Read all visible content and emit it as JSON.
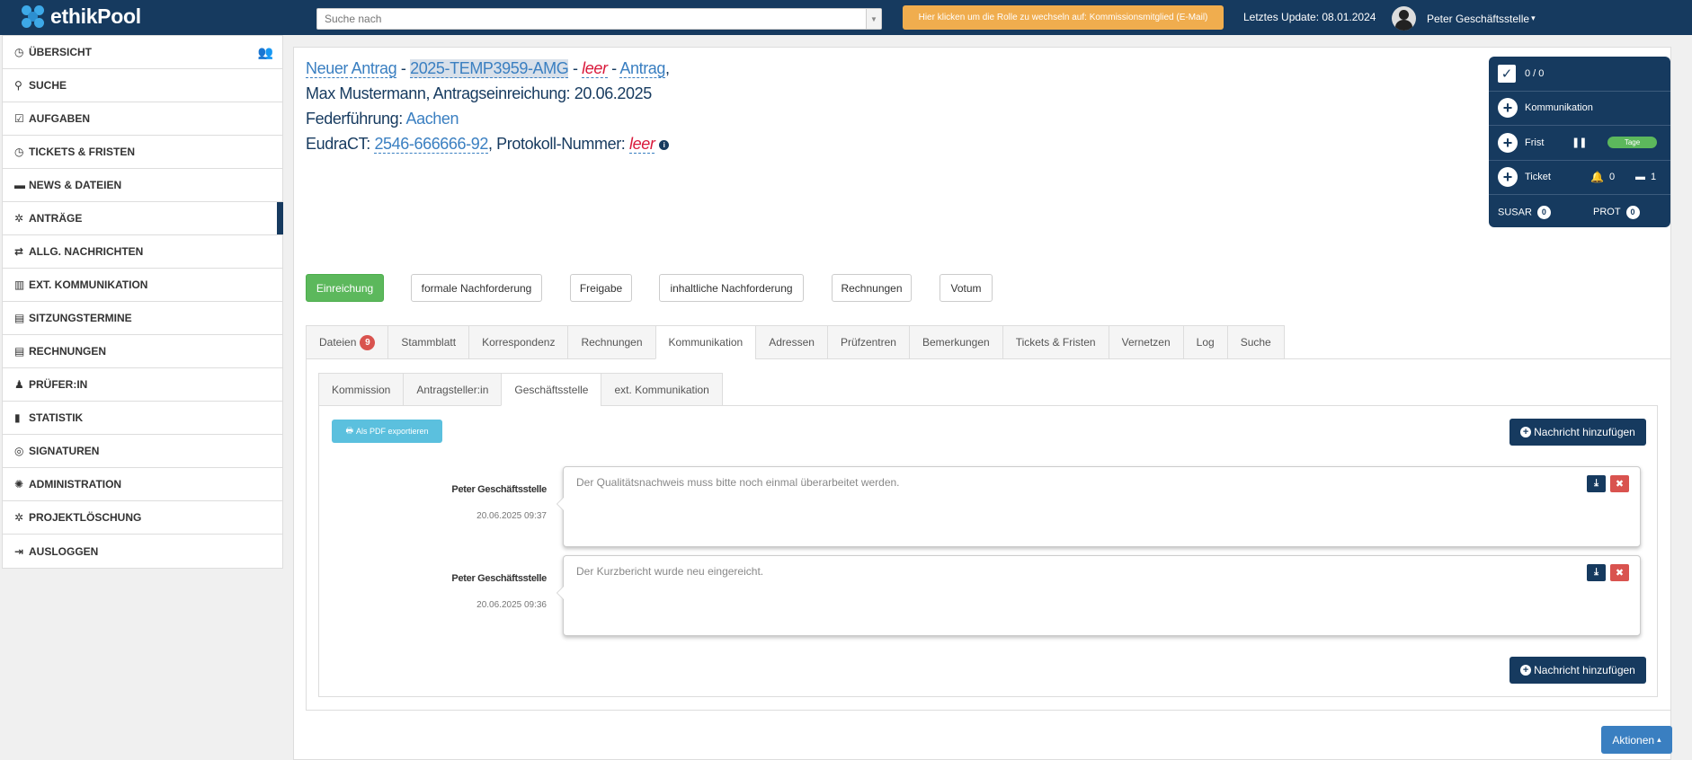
{
  "navbar": {
    "logo": "ethikPool",
    "search_placeholder": "Suche nach",
    "role_button": "Hier klicken um die Rolle zu wechseln auf: Kommissionsmitglied (E-Mail)",
    "last_update": "Letztes Update: 08.01.2024",
    "user_name": "Peter Geschäftsstelle",
    "user_caret": "▾"
  },
  "sidebar": {
    "items": [
      {
        "label": "ÜBERSICHT",
        "icon": "clock-icon",
        "glyph": "◷"
      },
      {
        "label": "SUCHE",
        "icon": "search-icon",
        "glyph": "⚲"
      },
      {
        "label": "AUFGABEN",
        "icon": "checkbox-icon",
        "glyph": "☑"
      },
      {
        "label": "TICKETS & FRISTEN",
        "icon": "clock-icon",
        "glyph": "◷"
      },
      {
        "label": "NEWS & DATEIEN",
        "icon": "comment-icon",
        "glyph": "▬"
      },
      {
        "label": "ANTRÄGE",
        "icon": "gear-icon",
        "glyph": "✲"
      },
      {
        "label": "ALLG. NACHRICHTEN",
        "icon": "transfer-icon",
        "glyph": "⇄"
      },
      {
        "label": "EXT. KOMMUNIKATION",
        "icon": "building-icon",
        "glyph": "▥"
      },
      {
        "label": "SITZUNGSTERMINE",
        "icon": "book-icon",
        "glyph": "▤"
      },
      {
        "label": "RECHNUNGEN",
        "icon": "list-icon",
        "glyph": "▤"
      },
      {
        "label": "PRÜFER:IN",
        "icon": "user-icon",
        "glyph": "♟"
      },
      {
        "label": "STATISTIK",
        "icon": "stats-icon",
        "glyph": "▮"
      },
      {
        "label": "SIGNATUREN",
        "icon": "fingerprint-icon",
        "glyph": "◎"
      },
      {
        "label": "ADMINISTRATION",
        "icon": "cog-icon",
        "glyph": "✺"
      },
      {
        "label": "PROJEKTLÖSCHUNG",
        "icon": "gear-icon",
        "glyph": "✲"
      },
      {
        "label": "AUSLOGGEN",
        "icon": "logout-icon",
        "glyph": "⇥"
      }
    ],
    "people_icon_glyph": "👥"
  },
  "header": {
    "neuer_antrag": "Neuer Antrag",
    "sep1": " - ",
    "temp_id": "2025-TEMP3959-AMG",
    "sep2": " - ",
    "leer1": "leer",
    "sep3": " - ",
    "antrag": "Antrag",
    "comma1": ",",
    "line2": "Max Mustermann, Antragseinreichung: 20.06.2025",
    "federfuehrung_label": "Federführung: ",
    "federfuehrung_value": "Aachen",
    "eudract_label": "EudraCT: ",
    "eudract_value": "2546-666666-92",
    "protokoll_label": ", Protokoll-Nummer: ",
    "leer2": "leer",
    "info_glyph": "i"
  },
  "widget": {
    "check_glyph": "✓",
    "count": "0 / 0",
    "plus_glyph": "+",
    "kommunikation": "Kommunikation",
    "frist": "Frist",
    "pause_glyph": "❚❚",
    "tage": "Tage",
    "ticket": "Ticket",
    "bell_glyph": "🔔",
    "bell_count": "0",
    "ticket_glyph": "▬",
    "ticket_count": "1",
    "susar": "SUSAR",
    "susar_count": "0",
    "prot": "PROT",
    "prot_count": "0"
  },
  "actions": {
    "einreichung": "Einreichung",
    "formale": "formale Nachforderung",
    "freigabe": "Freigabe",
    "inhaltliche": "inhaltliche Nachforderung",
    "rechnungen": "Rechnungen",
    "votum": "Votum"
  },
  "tabs": {
    "dateien": "Dateien",
    "dateien_count": "9",
    "stammblatt": "Stammblatt",
    "korrespondenz": "Korrespondenz",
    "rechnungen": "Rechnungen",
    "kommunikation": "Kommunikation",
    "adressen": "Adressen",
    "pruefzentren": "Prüfzentren",
    "bemerkungen": "Bemerkungen",
    "tickets": "Tickets & Fristen",
    "vernetzen": "Vernetzen",
    "log": "Log",
    "suche": "Suche"
  },
  "subtabs": {
    "kommission": "Kommission",
    "antragsteller": "Antragsteller:in",
    "geschaeftsstelle": "Geschäftsstelle",
    "ext": "ext. Kommunikation"
  },
  "comm": {
    "pdf_glyph": "🖶",
    "pdf_label": "Als PDF exportieren",
    "add_label": "Nachricht hinzufügen",
    "add_glyph": "+",
    "download_glyph": "⤓",
    "delete_glyph": "✖",
    "messages": [
      {
        "author": "Peter Geschäftsstelle",
        "time": "20.06.2025 09:37",
        "text": "Der Qualitätsnachweis muss bitte noch einmal überarbeitet werden."
      },
      {
        "author": "Peter Geschäftsstelle",
        "time": "20.06.2025 09:36",
        "text": "Der Kurzbericht wurde neu eingereicht."
      }
    ]
  },
  "footer": {
    "aktionen": "Aktionen",
    "caret": "▴"
  },
  "colors": {
    "navy": "#163a5f",
    "orange": "#f0ad4e",
    "green": "#5cb85c",
    "info": "#5bc0de",
    "danger": "#d9534f",
    "link": "#3a7fc1"
  }
}
